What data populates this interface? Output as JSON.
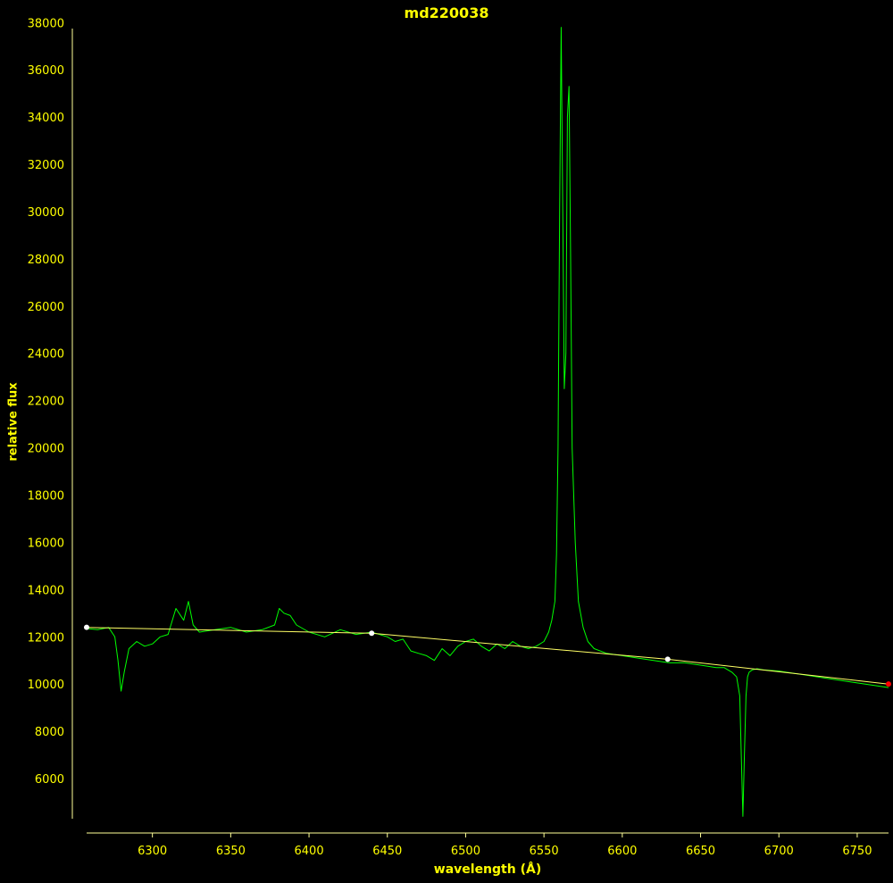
{
  "colors": {
    "background": "#000000",
    "text": "#ffff00",
    "axis": "#ffff99",
    "spectrum": "#00ff00",
    "continuum": "#ffff66",
    "markers": "#ffffff",
    "end_marker": "#ff0000"
  },
  "chart_data": {
    "type": "line",
    "title": "md220038",
    "xlabel": "wavelength (Å)",
    "ylabel": "relative flux",
    "xlim": [
      6258,
      6770
    ],
    "ylim": [
      4300,
      38200
    ],
    "xticks": [
      6300,
      6350,
      6400,
      6450,
      6500,
      6550,
      6600,
      6650,
      6700,
      6750
    ],
    "yticks": [
      6000,
      8000,
      10000,
      12000,
      14000,
      16000,
      18000,
      20000,
      22000,
      24000,
      26000,
      28000,
      30000,
      32000,
      34000,
      36000,
      38000
    ],
    "grid": false,
    "series": [
      {
        "role": "spectrum",
        "x": [
          6258,
          6265,
          6272,
          6276,
          6278,
          6280,
          6282,
          6285,
          6290,
          6295,
          6300,
          6305,
          6310,
          6315,
          6320,
          6323,
          6326,
          6330,
          6340,
          6350,
          6360,
          6370,
          6378,
          6381,
          6384,
          6388,
          6392,
          6400,
          6410,
          6420,
          6430,
          6440,
          6450,
          6455,
          6460,
          6465,
          6470,
          6475,
          6480,
          6485,
          6490,
          6495,
          6500,
          6505,
          6510,
          6515,
          6520,
          6525,
          6530,
          6535,
          6540,
          6545,
          6550,
          6553,
          6555,
          6557,
          6558,
          6559,
          6560,
          6561,
          6562,
          6563,
          6564,
          6565,
          6566,
          6567,
          6568,
          6570,
          6572,
          6575,
          6578,
          6582,
          6590,
          6600,
          6610,
          6620,
          6630,
          6640,
          6650,
          6660,
          6665,
          6670,
          6673,
          6675,
          6676,
          6677,
          6678,
          6679,
          6680,
          6681,
          6683,
          6686,
          6690,
          6700,
          6710,
          6720,
          6730,
          6740,
          6750,
          6760,
          6770
        ],
        "y": [
          12350,
          12300,
          12400,
          12000,
          11000,
          9700,
          10500,
          11500,
          11800,
          11600,
          11700,
          12000,
          12100,
          13200,
          12700,
          13500,
          12500,
          12200,
          12300,
          12400,
          12200,
          12300,
          12500,
          13200,
          13000,
          12900,
          12500,
          12200,
          12000,
          12300,
          12100,
          12200,
          12000,
          11800,
          11900,
          11400,
          11300,
          11200,
          11000,
          11500,
          11200,
          11600,
          11800,
          11900,
          11600,
          11400,
          11700,
          11500,
          11800,
          11600,
          11500,
          11600,
          11800,
          12200,
          12700,
          13500,
          15500,
          20000,
          30000,
          37800,
          30000,
          22500,
          24000,
          34000,
          35300,
          28000,
          20000,
          16000,
          13500,
          12400,
          11800,
          11500,
          11300,
          11200,
          11100,
          11000,
          10900,
          10900,
          10800,
          10700,
          10700,
          10500,
          10300,
          9500,
          7000,
          4400,
          7000,
          9500,
          10300,
          10500,
          10600,
          10650,
          10600,
          10550,
          10450,
          10350,
          10250,
          10150,
          10050,
          9950,
          9850
        ]
      },
      {
        "role": "continuum",
        "x": [
          6258,
          6440,
          6629,
          6770
        ],
        "y": [
          12400,
          12150,
          11050,
          10000
        ]
      }
    ],
    "points": [
      {
        "x": 6258,
        "y": 12400,
        "color": "white"
      },
      {
        "x": 6440,
        "y": 12150,
        "color": "white"
      },
      {
        "x": 6629,
        "y": 11050,
        "color": "white"
      },
      {
        "x": 6770,
        "y": 10000,
        "color": "red"
      }
    ]
  }
}
